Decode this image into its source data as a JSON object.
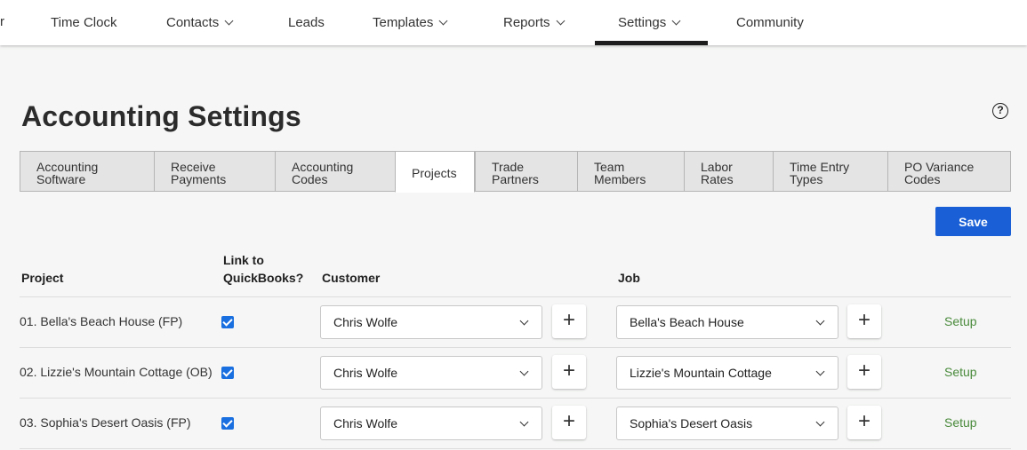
{
  "nav": {
    "edge_fragment": "r",
    "items": [
      {
        "label": "Time Clock"
      },
      {
        "label": "Contacts"
      },
      {
        "label": "Leads"
      },
      {
        "label": "Templates"
      },
      {
        "label": "Reports"
      },
      {
        "label": "Settings"
      },
      {
        "label": "Community"
      }
    ]
  },
  "page": {
    "title": "Accounting Settings",
    "help_glyph": "?"
  },
  "tabs": [
    {
      "line1": "Accounting",
      "line2": "Software"
    },
    {
      "line1": "Receive",
      "line2": "Payments"
    },
    {
      "line1": "Accounting",
      "line2": "Codes"
    },
    {
      "line1": "Projects",
      "line2": ""
    },
    {
      "line1": "Trade",
      "line2": "Partners"
    },
    {
      "line1": "Team",
      "line2": "Members"
    },
    {
      "line1": "Labor",
      "line2": "Rates"
    },
    {
      "line1": "Time Entry",
      "line2": "Types"
    },
    {
      "line1": "PO Variance",
      "line2": "Codes"
    }
  ],
  "save_label": "Save",
  "table": {
    "headers": {
      "project": "Project",
      "link_line1": "Link to",
      "link_line2": "QuickBooks?",
      "customer": "Customer",
      "job": "Job"
    },
    "rows": [
      {
        "project": "01. Bella's Beach House (FP)",
        "linked": true,
        "customer": "Chris Wolfe",
        "job": "Bella's Beach House",
        "action": "Setup"
      },
      {
        "project": "02. Lizzie's Mountain Cottage (OB)",
        "linked": true,
        "customer": "Chris Wolfe",
        "job": "Lizzie's Mountain Cottage",
        "action": "Setup"
      },
      {
        "project": "03. Sophia's Desert Oasis (FP)",
        "linked": true,
        "customer": "Chris Wolfe",
        "job": "Sophia's Desert Oasis",
        "action": "Setup"
      }
    ],
    "plus_glyph": "+"
  },
  "colors": {
    "primary": "#1a5fd6",
    "setup_link": "#4a8a3c",
    "checkbox": "#1a6fe0"
  }
}
